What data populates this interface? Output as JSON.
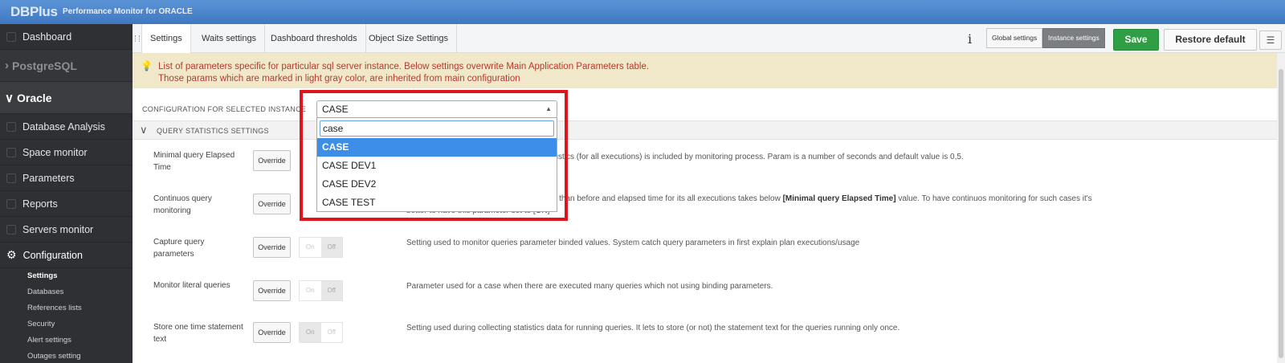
{
  "app": {
    "logo": "DBPlus",
    "subtitle": "Performance Monitor  for ORACLE"
  },
  "sidebar": {
    "dashboard": "Dashboard",
    "group_postgres": "PostgreSQL",
    "group_oracle": "Oracle",
    "items": [
      {
        "label": "Database Analysis",
        "icon": "database-analysis-icon"
      },
      {
        "label": "Space monitor",
        "icon": "database-icon"
      },
      {
        "label": "Parameters",
        "icon": "parameters-icon"
      },
      {
        "label": "Reports",
        "icon": "book-icon"
      },
      {
        "label": "Servers monitor",
        "icon": "server-icon"
      }
    ],
    "configuration": "Configuration",
    "sub_items": [
      "Settings",
      "Databases",
      "References lists",
      "Security",
      "Alert settings",
      "Outages setting"
    ]
  },
  "tabs": [
    "Settings",
    "Waits settings",
    "Dashboard thresholds",
    "Object Size Settings"
  ],
  "toolbar": {
    "info": "i",
    "global_settings": "Global settings",
    "instance_settings": "Instance settings",
    "save": "Save",
    "restore": "Restore default",
    "menu_icon": "☰"
  },
  "notice": {
    "line1": "List of parameters specific for particular sql server instance. Below settings overwrite Main Application Parameters table.",
    "line2": "Those params which are marked in light gray color, are inherited from main configuration"
  },
  "config": {
    "label": "CONFIGURATION FOR SELECTED INSTANCE",
    "selected": "CASE",
    "search_value": "case",
    "options": [
      "CASE",
      "CASE DEV1",
      "CASE DEV2",
      "CASE TEST"
    ]
  },
  "section": {
    "title": "QUERY STATISTICS SETTINGS"
  },
  "params": [
    {
      "name": "Minimal query Elapsed Time",
      "override": "Override",
      "desc": "Elapsed/Cpu Time above which query statistics (for all executions) is included by monitoring process. Param is a number of seconds and default value is 0,5."
    },
    {
      "name": "Continuos query monitoring",
      "override": "Override",
      "desc_a": "rticular query started to be executed faster than before and elapsed time for its all executions takes below ",
      "desc_b": "[Minimal query Elapsed Time]",
      "desc_c": " value. To have continuos monitoring for such cases it's",
      "desc_d": "better to have this parameter set to [ON]"
    },
    {
      "name": "Capture query parameters",
      "override": "Override",
      "on": "On",
      "off": "Off",
      "desc": "Setting used to monitor queries parameter binded values. System catch query parameters in first explain plan executions/usage"
    },
    {
      "name": "Monitor literal queries",
      "override": "Override",
      "on": "On",
      "off": "Off",
      "desc": "Parameter used for a case when there are executed many queries which not using binding parameters."
    },
    {
      "name": "Store one time statement text",
      "override": "Override",
      "on": "On",
      "off": "Off",
      "desc": "Setting used during collecting statistics data for running queries. It lets to store (or not) the statement text for the queries running only once."
    }
  ]
}
